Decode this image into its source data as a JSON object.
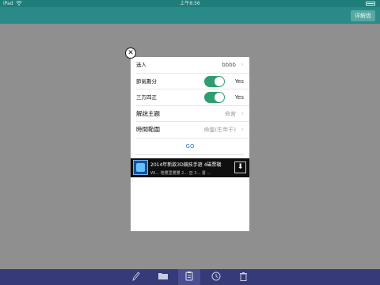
{
  "status_bar": {
    "carrier": "iPad",
    "clock": "上午8:56"
  },
  "nav": {
    "right_button": "详解盘"
  },
  "form": {
    "rows": [
      {
        "label": "选人",
        "value": "bbbb"
      },
      {
        "label": "節氣劃分",
        "value": "Yes",
        "toggle_on": true
      },
      {
        "label": "三方四正",
        "value": "Yes",
        "toggle_on": true
      },
      {
        "label": "解說主題",
        "value": "命宮"
      },
      {
        "label": "時間範圍",
        "value": "命盤(生年干)"
      }
    ],
    "go_label": "GO"
  },
  "ad": {
    "title": "2014年新款3D競技手遊 4磁票戰",
    "subtitle": "Wi... 賠豐里豐豐 2... 亞 3... 書 ..."
  },
  "tabbar": {
    "icons": [
      "pencil-icon",
      "folder-icon",
      "clipboard-icon",
      "clock-icon",
      "trash-icon"
    ],
    "active_index": 2
  },
  "colors": {
    "nav": "#2a8a87",
    "dim": "#8f8f8f",
    "toggle": "#2f9e6e",
    "link": "#2a78d6",
    "tabbar": "#363a77"
  }
}
